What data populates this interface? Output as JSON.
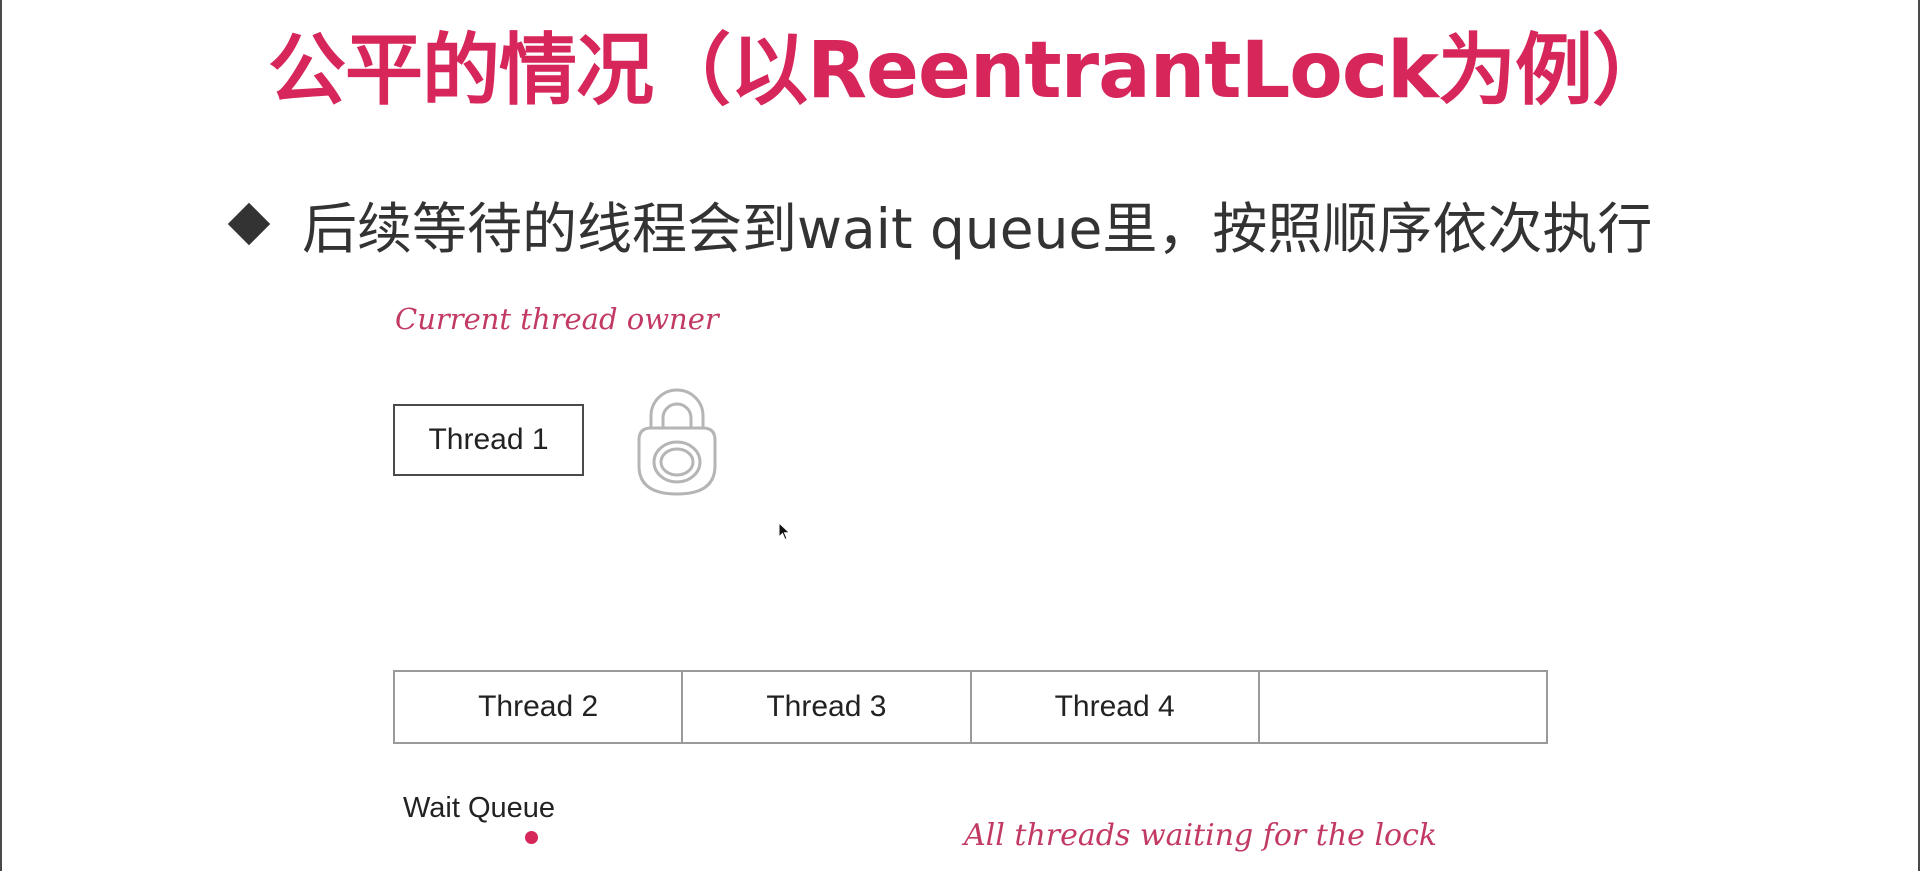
{
  "slide": {
    "title": "公平的情况（以ReentrantLock为例）",
    "bullet": "后续等待的线程会到wait queue里，按照顺序依次执行"
  },
  "diagram": {
    "owner_label": "Current thread owner",
    "owner_thread": "Thread 1",
    "queue_cells": [
      "Thread 2",
      "Thread 3",
      "Thread 4",
      ""
    ],
    "queue_label": "Wait Queue",
    "waiting_label": "All threads waiting for the lock"
  },
  "colors": {
    "title": "#d6265a",
    "annotation": "#c23a63",
    "text": "#333333",
    "accent_dot": "#d6265a"
  },
  "icons": {
    "bullet": "diamond-bullet-icon",
    "lock": "padlock-icon",
    "cursor": "mouse-pointer-icon"
  }
}
